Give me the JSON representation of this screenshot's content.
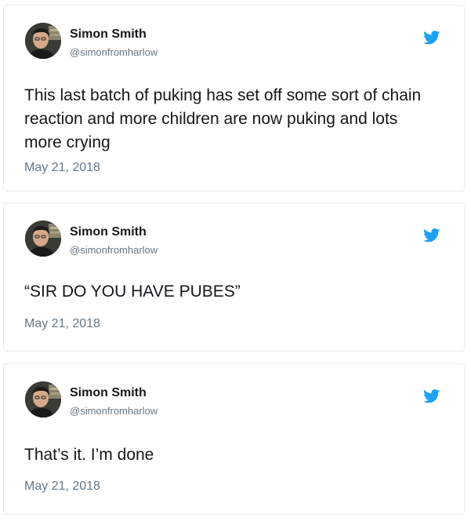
{
  "accent_color": "#1da1f2",
  "icons": {
    "brand": "twitter-bird-icon",
    "avatar": "profile-photo"
  },
  "tweets": [
    {
      "author_name": "Simon Smith",
      "handle": "@simonfromharlow",
      "text": "This last batch of puking has set off some sort of chain reaction and more children are now puking and lots more crying",
      "date": "May 21, 2018"
    },
    {
      "author_name": "Simon Smith",
      "handle": "@simonfromharlow",
      "text": "“SIR DO YOU HAVE PUBES”",
      "date": "May 21, 2018"
    },
    {
      "author_name": "Simon Smith",
      "handle": "@simonfromharlow",
      "text": "That’s it. I’m done",
      "date": "May 21, 2018"
    }
  ]
}
